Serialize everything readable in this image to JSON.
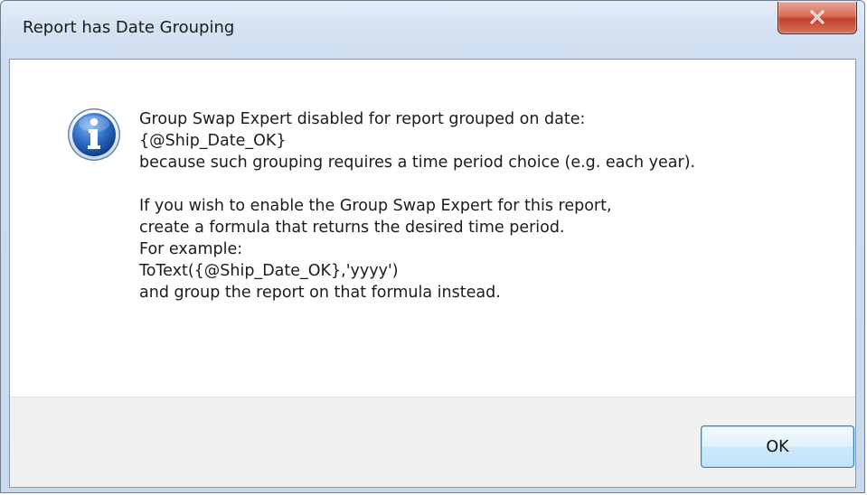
{
  "window": {
    "title": "Report has Date Grouping"
  },
  "icons": {
    "dialog_icon": "info-icon",
    "close_icon": "close-icon"
  },
  "message": {
    "lines": [
      "Group Swap Expert disabled for report grouped on date:",
      "{@Ship_Date_OK}",
      "because such grouping requires a time period choice (e.g. each year).",
      "",
      "If you wish to enable the Group Swap Expert for this report,",
      "create a formula that returns the desired time period.",
      "For example:",
      "ToText({@Ship_Date_OK},'yyyy')",
      "and group the report on that formula instead."
    ]
  },
  "buttons": {
    "ok_label": "OK"
  },
  "colors": {
    "close_button_red": "#c2422b",
    "ok_button_border": "#3c7fb1",
    "info_icon_blue": "#1f5fb4",
    "footer_bg": "#f0f0f0"
  }
}
